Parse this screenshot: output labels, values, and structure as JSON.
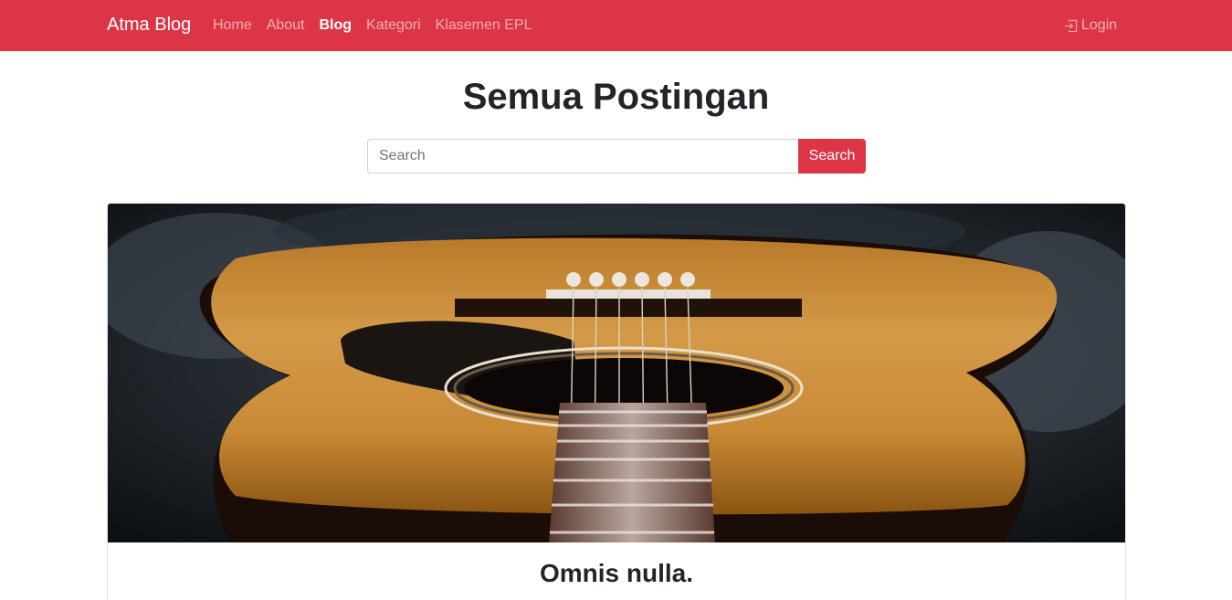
{
  "navbar": {
    "brand": "Atma Blog",
    "links": [
      {
        "label": "Home"
      },
      {
        "label": "About"
      },
      {
        "label": "Blog"
      },
      {
        "label": "Kategori"
      },
      {
        "label": "Klasemen EPL"
      }
    ],
    "active": "Blog",
    "login_label": "Login",
    "login_icon": "box-arrow-in-right-icon"
  },
  "page": {
    "title": "Semua Postingan"
  },
  "search": {
    "placeholder": "Search",
    "value": "",
    "button_label": "Search"
  },
  "posts": [
    {
      "title": "Omnis nulla.",
      "image": "acoustic-guitar-photo"
    }
  ],
  "colors": {
    "primary": "#dc3545",
    "text": "#212529",
    "white": "#ffffff"
  }
}
